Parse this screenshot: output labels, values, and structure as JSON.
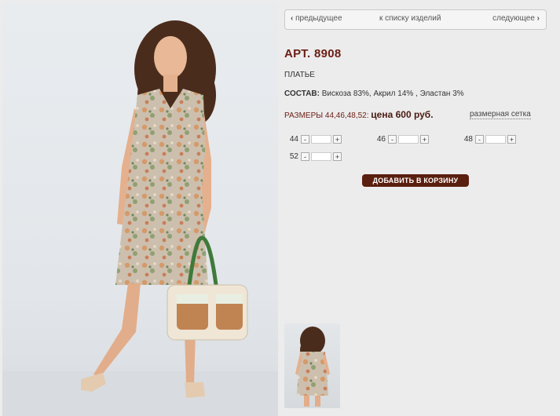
{
  "nav": {
    "prev_label": "предыдущее",
    "list_label": "к списку изделий",
    "next_label": "следующее",
    "prev_icon": "chevron-left-icon",
    "next_icon": "chevron-right-icon"
  },
  "product": {
    "article": "АРТ. 8908",
    "type": "ПЛАТЬЕ",
    "composition_label": "СОСТАВ:",
    "composition_value": "Вискоза 83%, Акрил 14% , Эластан 3%",
    "sizes_label": "РАЗМЕРЫ 44,46,48,52:",
    "price": "цена 600 руб.",
    "size_chart_link": "размерная сетка"
  },
  "size_selectors": [
    {
      "size": "44",
      "minus": "-",
      "plus": "+",
      "value": ""
    },
    {
      "size": "46",
      "minus": "-",
      "plus": "+",
      "value": ""
    },
    {
      "size": "48",
      "minus": "-",
      "plus": "+",
      "value": ""
    },
    {
      "size": "52",
      "minus": "-",
      "plus": "+",
      "value": ""
    }
  ],
  "cart": {
    "add_label": "ДОБАВИТЬ В КОРЗИНУ"
  },
  "colors": {
    "accent": "#6a1e14",
    "button": "#5a1f0f",
    "background": "#ececec"
  }
}
